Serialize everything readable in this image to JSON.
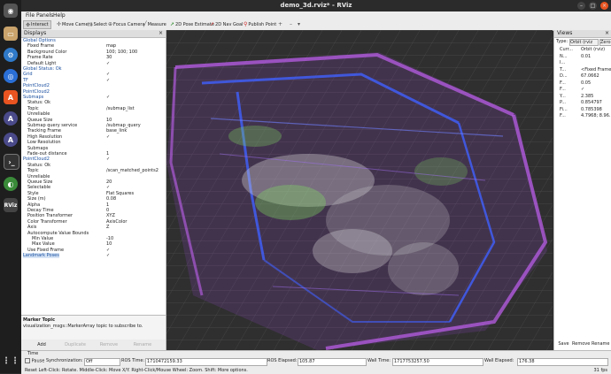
{
  "window": {
    "title": "demo_3d.rviz* - RViz"
  },
  "menu": [
    "File",
    "Panels",
    "Help"
  ],
  "toolbar": [
    {
      "label": "Interact",
      "icon": "interact-icon"
    },
    {
      "label": "Move Camera",
      "icon": "move-camera-icon"
    },
    {
      "label": "Select",
      "icon": "select-icon"
    },
    {
      "label": "Focus Camera",
      "icon": "focus-camera-icon"
    },
    {
      "label": "Measure",
      "icon": "measure-icon"
    },
    {
      "label": "2D Pose Estimate",
      "icon": "pose-estimate-icon"
    },
    {
      "label": "2D Nav Goal",
      "icon": "nav-goal-icon"
    },
    {
      "label": "Publish Point",
      "icon": "publish-point-icon"
    }
  ],
  "displays": {
    "title": "Displays",
    "rows": [
      {
        "label": "Global Options",
        "value": "",
        "indent": 1
      },
      {
        "label": "Fixed Frame",
        "value": "map",
        "indent": 2
      },
      {
        "label": "Background Color",
        "value": "100; 100; 100",
        "indent": 2
      },
      {
        "label": "Frame Rate",
        "value": "30",
        "indent": 2
      },
      {
        "label": "Default Light",
        "value": "✓",
        "indent": 2
      },
      {
        "label": "Global Status: Ok",
        "value": "",
        "indent": 1
      },
      {
        "label": "Grid",
        "value": "✓",
        "indent": 1
      },
      {
        "label": "TF",
        "value": "✓",
        "indent": 1
      },
      {
        "label": "PointCloud2",
        "value": "",
        "indent": 1
      },
      {
        "label": "PointCloud2",
        "value": "",
        "indent": 1
      },
      {
        "label": "Submaps",
        "value": "✓",
        "indent": 1
      },
      {
        "label": "Status: Ok",
        "value": "",
        "indent": 2
      },
      {
        "label": "Topic",
        "value": "/submap_list",
        "indent": 2
      },
      {
        "label": "Unreliable",
        "value": "",
        "indent": 2
      },
      {
        "label": "Queue Size",
        "value": "10",
        "indent": 2
      },
      {
        "label": "Submap query service",
        "value": "/submap_query",
        "indent": 2
      },
      {
        "label": "Tracking Frame",
        "value": "base_link",
        "indent": 2
      },
      {
        "label": "High Resolution",
        "value": "✓",
        "indent": 2
      },
      {
        "label": "Low Resolution",
        "value": "",
        "indent": 2
      },
      {
        "label": "Submaps",
        "value": "",
        "indent": 2
      },
      {
        "label": "Fade-out distance",
        "value": "1",
        "indent": 2
      },
      {
        "label": "PointCloud2",
        "value": "✓",
        "indent": 1
      },
      {
        "label": "Status: Ok",
        "value": "",
        "indent": 2
      },
      {
        "label": "Topic",
        "value": "/scan_matched_points2",
        "indent": 2
      },
      {
        "label": "Unreliable",
        "value": "",
        "indent": 2
      },
      {
        "label": "Queue Size",
        "value": "20",
        "indent": 2
      },
      {
        "label": "Selectable",
        "value": "✓",
        "indent": 2
      },
      {
        "label": "Style",
        "value": "Flat Squares",
        "indent": 2
      },
      {
        "label": "Size (m)",
        "value": "0.08",
        "indent": 2
      },
      {
        "label": "Alpha",
        "value": "1",
        "indent": 2
      },
      {
        "label": "Decay Time",
        "value": "0",
        "indent": 2
      },
      {
        "label": "Position Transformer",
        "value": "XYZ",
        "indent": 2
      },
      {
        "label": "Color Transformer",
        "value": "AxisColor",
        "indent": 2
      },
      {
        "label": "Axis",
        "value": "Z",
        "indent": 2
      },
      {
        "label": "Autocompute Value Bounds",
        "value": "",
        "indent": 2
      },
      {
        "label": "Min Value",
        "value": "-10",
        "indent": 3
      },
      {
        "label": "Max Value",
        "value": "10",
        "indent": 3
      },
      {
        "label": "Use Fixed Frame",
        "value": "✓",
        "indent": 2
      },
      {
        "label": "Landmark Poses",
        "value": "✓",
        "indent": 1
      }
    ],
    "desc_title": "Marker Topic",
    "desc_text": "visualization_msgs::MarkerArray topic to subscribe to.",
    "buttons": [
      "Add",
      "Duplicate",
      "Remove",
      "Rename"
    ]
  },
  "views": {
    "title": "Views",
    "type_label": "Type:",
    "type_value": "Orbit (rviz",
    "zero": "Zero",
    "rows": [
      {
        "label": "Curr...",
        "value": "Orbit (rviz)"
      },
      {
        "label": "N...",
        "value": "0.01"
      },
      {
        "label": "I...",
        "value": ""
      },
      {
        "label": "T...",
        "value": "<Fixed Frame>"
      },
      {
        "label": "D...",
        "value": "67.0662"
      },
      {
        "label": "F...",
        "value": "0.05"
      },
      {
        "label": "F...",
        "value": "✓"
      },
      {
        "label": "Y...",
        "value": "2.385"
      },
      {
        "label": "P...",
        "value": "0.854797"
      },
      {
        "label": "Fi...",
        "value": "0.785398"
      },
      {
        "label": "F...",
        "value": "4.7968; 8.96..."
      }
    ],
    "buttons": [
      "Save",
      "Remove",
      "Rename"
    ]
  },
  "time": {
    "title": "Time",
    "pause": "Pause",
    "sync_label": "Synchronization:",
    "sync_value": "Off",
    "ros_time_label": "ROS Time:",
    "ros_time": "1710472159.33",
    "ros_elapsed_label": "ROS Elapsed:",
    "ros_elapsed": "105.87",
    "wall_time_label": "Wall Time:",
    "wall_time": "1717753257.50",
    "wall_elapsed_label": "Wall Elapsed:",
    "wall_elapsed": "176.38",
    "status": "Reset  Left-Click: Rotate. Middle-Click: Move X/Y. Right-Click/Mouse Wheel: Zoom. Shift: More options.",
    "fps": "31 fps"
  },
  "colors": {
    "accent": "#d6e4f5",
    "cloud_purple": "#c060f0",
    "cloud_blue": "#4060ff",
    "cloud_green": "#80e060"
  }
}
